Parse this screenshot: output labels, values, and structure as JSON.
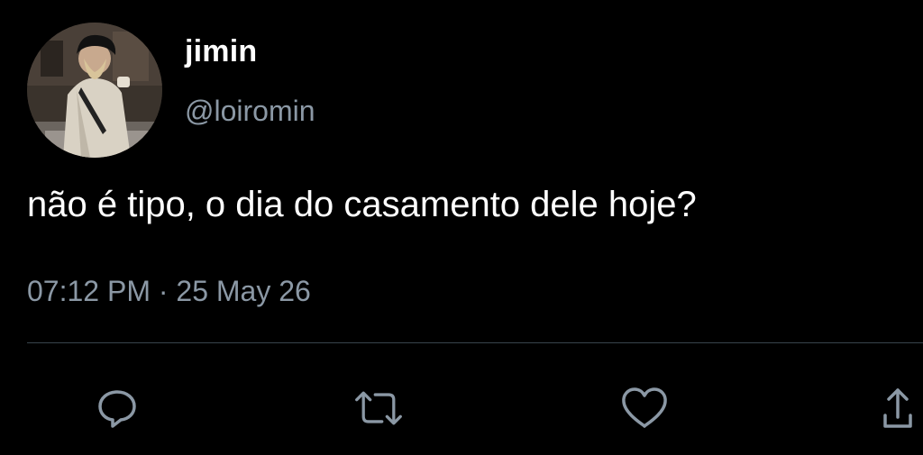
{
  "author": {
    "display_name": "jimin",
    "handle": "@loiromin",
    "avatar_icon": "profile-photo"
  },
  "tweet": {
    "text": "não é tipo, o dia do casamento dele hoje?",
    "time": "07:12 PM",
    "separator": "·",
    "date": "25 May 26"
  },
  "actions": {
    "reply_icon": "speech-bubble-icon",
    "retweet_icon": "retweet-arrows-icon",
    "like_icon": "heart-icon",
    "share_icon": "share-upload-icon"
  },
  "colors": {
    "background": "#000000",
    "text_primary": "#ffffff",
    "text_secondary": "#8b98a5",
    "icon": "#8b98a5",
    "divider": "#38444d"
  }
}
